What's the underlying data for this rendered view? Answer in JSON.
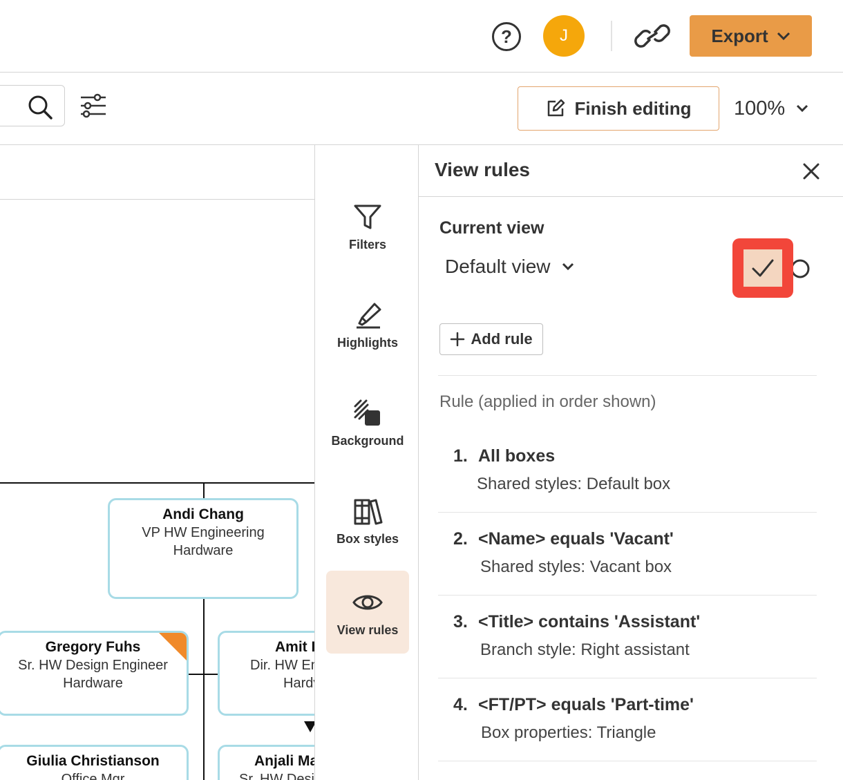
{
  "topbar": {
    "avatar_initial": "J",
    "export_label": "Export"
  },
  "toolbar": {
    "finish_editing_label": "Finish editing",
    "zoom_level": "100%"
  },
  "chart": {
    "boxes": [
      {
        "name": "Andi Chang",
        "title": "VP HW Engineering",
        "dept": "Hardware"
      },
      {
        "name": "Gregory Fuhs",
        "title": "Sr. HW Design Engineer",
        "dept": "Hardware"
      },
      {
        "name": "Amit I",
        "title": "Dir. HW En",
        "dept": "Hardv"
      },
      {
        "name": "Giulia Christianson",
        "title": "Office Mgr"
      },
      {
        "name": "Anjali Ma",
        "title": "Sr. HW Desic"
      }
    ]
  },
  "rail": {
    "items": [
      {
        "label": "Filters",
        "icon": "funnel-icon"
      },
      {
        "label": "Highlights",
        "icon": "highlighter-icon"
      },
      {
        "label": "Background",
        "icon": "background-pattern-icon"
      },
      {
        "label": "Box styles",
        "icon": "books-icon"
      },
      {
        "label": "View rules",
        "icon": "eye-icon"
      }
    ]
  },
  "panel": {
    "title": "View rules",
    "current_view_label": "Current view",
    "current_view_value": "Default view",
    "add_rule_label": "Add rule",
    "rules_heading": "Rule (applied in order shown)",
    "rules": [
      {
        "num": "1.",
        "title": "All boxes",
        "desc": "Shared styles: Default box"
      },
      {
        "num": "2.",
        "title": "<Name> equals 'Vacant'",
        "desc": "Shared styles: Vacant box"
      },
      {
        "num": "3.",
        "title": "<Title> contains 'Assistant'",
        "desc": "Branch style: Right assistant"
      },
      {
        "num": "4.",
        "title": "<FT/PT> equals 'Part-time'",
        "desc": "Box properties: Triangle"
      }
    ]
  },
  "colors": {
    "accent_orange": "#e99b47",
    "avatar": "#f5a70b",
    "highlight_red": "#f2463a",
    "box_border": "#a8dbe6",
    "active_rail_bg": "#f8e8dc"
  }
}
